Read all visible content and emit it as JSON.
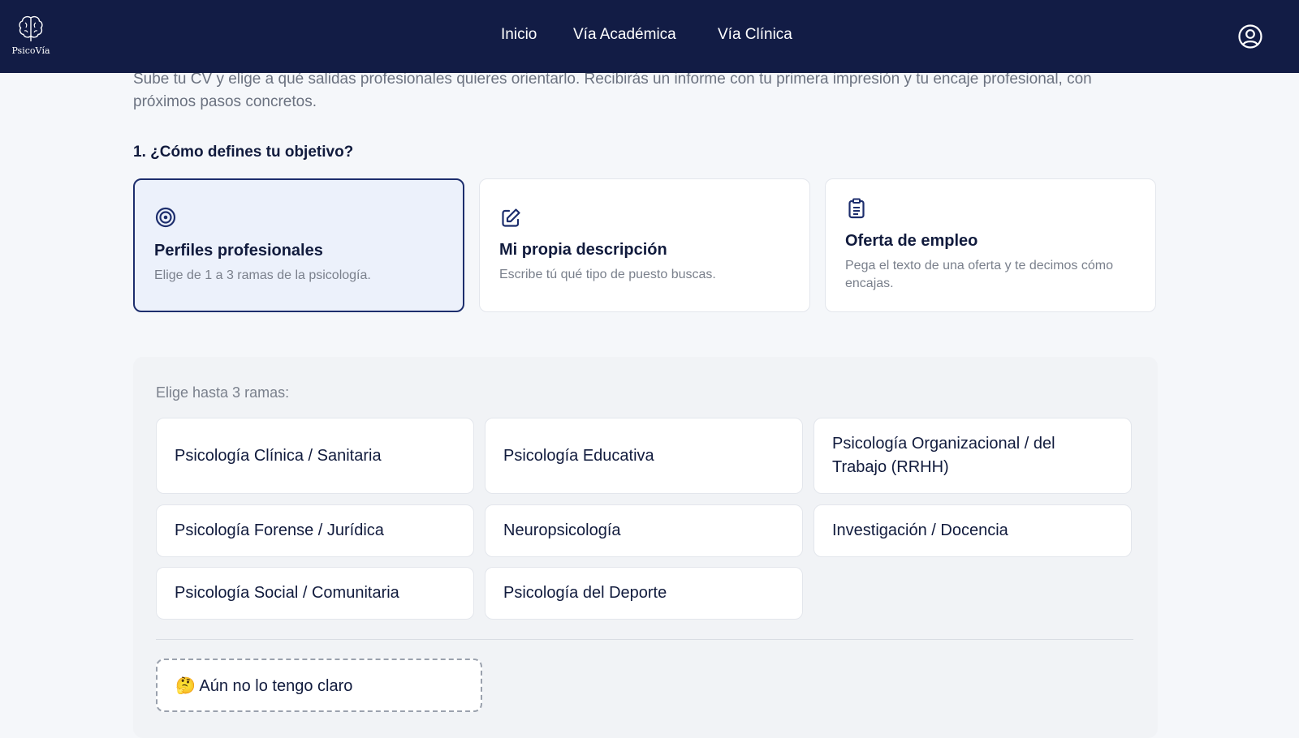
{
  "brand": {
    "name": "PsicoVía",
    "icon": "brain-icon"
  },
  "nav": {
    "items": [
      {
        "label": "Inicio"
      },
      {
        "label": "Vía Académica"
      },
      {
        "label": "Vía Clínica"
      }
    ],
    "user_icon": "user-circle-icon"
  },
  "intro": {
    "text": "Sube tu CV y elige a qué salidas profesionales quieres orientarlo. Recibirás un informe con tu primera impresión y tu encaje profesional, con próximos pasos concretos."
  },
  "objective": {
    "title": "1. ¿Cómo defines tu objetivo?",
    "options": [
      {
        "title": "Perfiles profesionales",
        "desc": "Elige de 1 a 3 ramas de la psicología.",
        "icon": "target-icon",
        "selected": true
      },
      {
        "title": "Mi propia descripción",
        "desc": "Escribe tú qué tipo de puesto buscas.",
        "icon": "edit-icon",
        "selected": false
      },
      {
        "title": "Oferta de empleo",
        "desc": "Pega el texto de una oferta y te decimos cómo encajas.",
        "icon": "clipboard-icon",
        "selected": false
      }
    ]
  },
  "branches": {
    "label": "Elige hasta 3 ramas:",
    "items": [
      "Psicología Clínica / Sanitaria",
      "Psicología Educativa",
      "Psicología Organizacional / del Trabajo (RRHH)",
      "Psicología Forense / Jurídica",
      "Neuropsicología",
      "Investigación / Docencia",
      "Psicología Social / Comunitaria",
      "Psicología del Deporte"
    ],
    "unsure_label": "🤔 Aún no lo tengo claro"
  },
  "colors": {
    "navbar": "#121c45",
    "accent": "#1d2e6d",
    "selected_bg": "#ecf1fb",
    "page_bg": "#f5f7fa"
  }
}
